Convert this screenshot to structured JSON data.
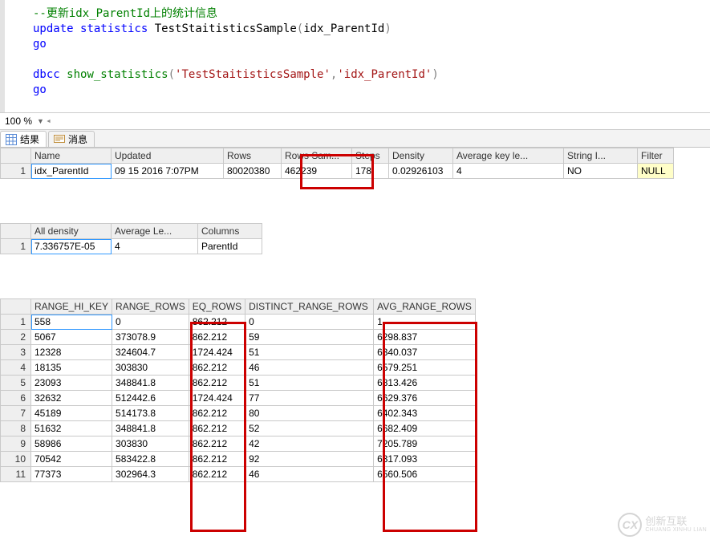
{
  "editor": {
    "lines": [
      {
        "tokens": [
          {
            "t": "--更新idx_ParentId上的统计信息",
            "c": "tok-comment"
          }
        ]
      },
      {
        "tokens": [
          {
            "t": "update",
            "c": "kw-blue"
          },
          {
            "t": " ",
            "c": ""
          },
          {
            "t": "statistics",
            "c": "kw-blue"
          },
          {
            "t": " TestStaitisticsSample",
            "c": ""
          },
          {
            "t": "(",
            "c": "tok-gray"
          },
          {
            "t": "idx_ParentId",
            "c": ""
          },
          {
            "t": ")",
            "c": "tok-gray"
          }
        ]
      },
      {
        "tokens": [
          {
            "t": "go",
            "c": "kw-blue"
          }
        ]
      },
      {
        "tokens": [
          {
            "t": "",
            "c": ""
          }
        ]
      },
      {
        "tokens": [
          {
            "t": "dbcc",
            "c": "kw-blue"
          },
          {
            "t": " ",
            "c": ""
          },
          {
            "t": "show_statistics",
            "c": "kw-green"
          },
          {
            "t": "(",
            "c": "tok-gray"
          },
          {
            "t": "'TestStaitisticsSample'",
            "c": "tok-string"
          },
          {
            "t": ",",
            "c": "tok-gray"
          },
          {
            "t": "'idx_ParentId'",
            "c": "tok-string"
          },
          {
            "t": ")",
            "c": "tok-gray"
          }
        ]
      },
      {
        "tokens": [
          {
            "t": "go",
            "c": "kw-blue"
          }
        ]
      }
    ]
  },
  "zoom": "100 %",
  "tabs": {
    "results": "结果",
    "messages": "消息"
  },
  "grid1": {
    "headers": [
      "Name",
      "Updated",
      "Rows",
      "Rows Sam...",
      "Steps",
      "Density",
      "Average key le...",
      "String I...",
      "Filter"
    ],
    "widths": [
      100,
      140,
      72,
      88,
      46,
      80,
      138,
      92,
      45
    ],
    "rows": [
      [
        "idx_ParentId",
        "09 15 2016  7:07PM",
        "80020380",
        "462239",
        "178",
        "0.02926103",
        "4",
        "NO",
        "NULL"
      ]
    ]
  },
  "grid2": {
    "headers": [
      "All density",
      "Average Le...",
      "Columns"
    ],
    "widths": [
      100,
      108,
      80
    ],
    "rows": [
      [
        "7.336757E-05",
        "4",
        "ParentId"
      ]
    ]
  },
  "grid3": {
    "headers": [
      "RANGE_HI_KEY",
      "RANGE_ROWS",
      "EQ_ROWS",
      "DISTINCT_RANGE_ROWS",
      "AVG_RANGE_ROWS"
    ],
    "widths": [
      98,
      80,
      66,
      160,
      112
    ],
    "rows": [
      [
        "558",
        "0",
        "862.212",
        "0",
        "1"
      ],
      [
        "5067",
        "373078.9",
        "862.212",
        "59",
        "6298.837"
      ],
      [
        "12328",
        "324604.7",
        "1724.424",
        "51",
        "6340.037"
      ],
      [
        "18135",
        "303830",
        "862.212",
        "46",
        "6579.251"
      ],
      [
        "23093",
        "348841.8",
        "862.212",
        "51",
        "6813.426"
      ],
      [
        "32632",
        "512442.6",
        "1724.424",
        "77",
        "6629.376"
      ],
      [
        "45189",
        "514173.8",
        "862.212",
        "80",
        "6402.343"
      ],
      [
        "51632",
        "348841.8",
        "862.212",
        "52",
        "6682.409"
      ],
      [
        "58986",
        "303830",
        "862.212",
        "42",
        "7205.789"
      ],
      [
        "70542",
        "583422.8",
        "862.212",
        "92",
        "6317.093"
      ],
      [
        "77373",
        "302964.3",
        "862.212",
        "46",
        "6560.506"
      ]
    ]
  },
  "watermark": {
    "logo": "CX",
    "line1": "创新互联",
    "line2": "CHUANG XINHU LIAN"
  }
}
